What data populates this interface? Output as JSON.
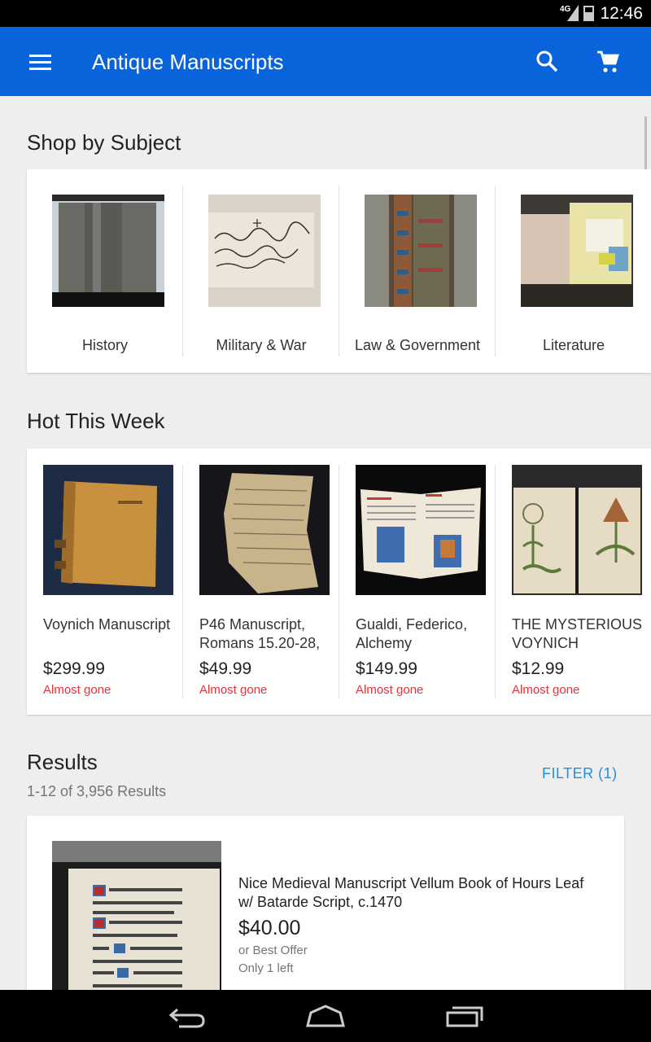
{
  "status": {
    "network": "4G",
    "time": "12:46"
  },
  "appbar": {
    "title": "Antique Manuscripts",
    "menu_icon": "menu-icon",
    "search_icon": "search-icon",
    "cart_icon": "cart-icon"
  },
  "shop_by_subject": {
    "heading": "Shop by Subject",
    "items": [
      {
        "label": "History"
      },
      {
        "label": "Military & War"
      },
      {
        "label": "Law & Government"
      },
      {
        "label": "Literature"
      }
    ]
  },
  "hot": {
    "heading": "Hot This Week",
    "items": [
      {
        "name": "Voynich Manuscript",
        "price": "$299.99",
        "note": "Almost gone"
      },
      {
        "name": "P46 Manuscript, Romans 15.20-28,",
        "price": "$49.99",
        "note": "Almost gone"
      },
      {
        "name": "Gualdi, Federico, Alchemy",
        "price": "$149.99",
        "note": "Almost gone"
      },
      {
        "name": "THE MYSTERIOUS VOYNICH",
        "price": "$12.99",
        "note": "Almost gone"
      }
    ]
  },
  "results": {
    "heading": "Results",
    "count": "1-12 of 3,956 Results",
    "filter_label": "FILTER (1)",
    "items": [
      {
        "title": "Nice Medieval Manuscript Vellum Book of Hours Leaf w/ Batarde Script, c.1470",
        "price": "$40.00",
        "offer": "or Best Offer",
        "stock": "Only 1 left"
      }
    ]
  },
  "colors": {
    "appbar": "#0964db",
    "accent": "#1f8fe0",
    "alert": "#e53238"
  }
}
